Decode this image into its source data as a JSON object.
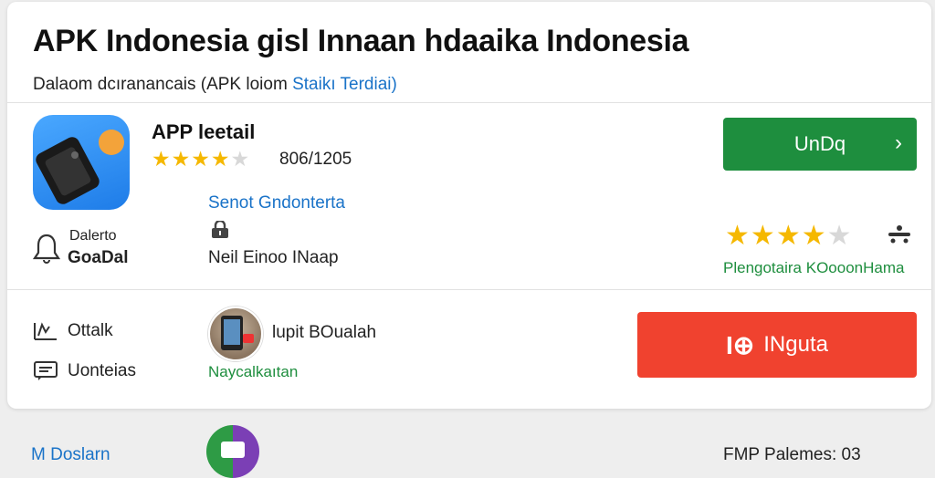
{
  "header": {
    "title": "APK Indonesia gisl Innaan hdaaika Indonesia",
    "subtitle_prefix": "Dalaom dcıranancais (APK loiom ",
    "subtitle_highlight": "Staikı Terdiai)"
  },
  "app": {
    "name": "APP leetail",
    "rating_stars": 4,
    "rating_max": 5,
    "rating_count": "806/1205",
    "link_text": "Senot Gndonterta",
    "meta_text": "Neil Einoo INaap"
  },
  "left_panel": {
    "label_top": "Dalerto",
    "label_bottom": "GoaDal"
  },
  "actions": {
    "primary_label": "UnDq",
    "secondary_label": "INguta",
    "secondary_icon_text": "I⊕"
  },
  "right_panel": {
    "rating_stars": 4,
    "rating_max": 5,
    "caption": "Plengotaira KOooonHama"
  },
  "rows": [
    {
      "icon": "chart-icon",
      "label": "Ottalk"
    },
    {
      "icon": "list-icon",
      "label": "Uonteias"
    }
  ],
  "author": {
    "name": "lupit BOualah",
    "subtitle": "Naycalkaıtan"
  },
  "footer": {
    "left_text": "M Doslarn",
    "right_text": "FMP Palemes: 03"
  },
  "colors": {
    "primary_green": "#1e8e3e",
    "accent_red": "#f0422f",
    "link_blue": "#1a73c8",
    "star_gold": "#f5b800"
  }
}
